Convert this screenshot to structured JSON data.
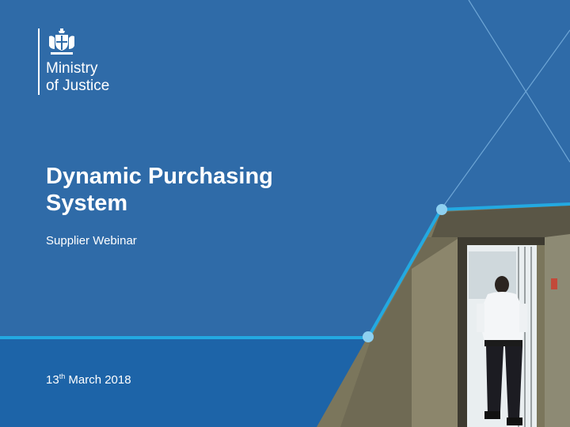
{
  "logo": {
    "line1": "Ministry",
    "line2": "of Justice"
  },
  "title": {
    "line1": "Dynamic Purchasing",
    "line2": "System"
  },
  "subtitle": "Supplier Webinar",
  "date": {
    "day": "13",
    "suffix": "th",
    "rest": "March 2018"
  },
  "colors": {
    "background": "#2f6ba8",
    "lower_band": "#1d64a8",
    "accent_line": "#23a9e1",
    "text": "#ffffff"
  }
}
